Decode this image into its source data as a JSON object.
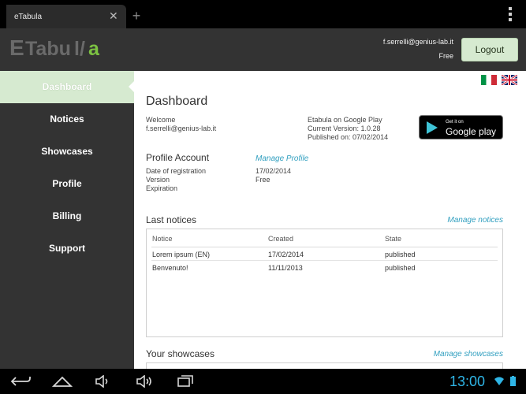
{
  "browser": {
    "tab_title": "eTabula",
    "tab_close": "✕",
    "new_tab": "+"
  },
  "header": {
    "logo_text": "ETabula",
    "user_email": "f.serrelli@genius-lab.it",
    "user_plan": "Free",
    "logout_label": "Logout"
  },
  "sidebar": {
    "items": [
      {
        "label": "Dashboard"
      },
      {
        "label": "Notices"
      },
      {
        "label": "Showcases"
      },
      {
        "label": "Profile"
      },
      {
        "label": "Billing"
      },
      {
        "label": "Support"
      }
    ]
  },
  "dashboard": {
    "title": "Dashboard",
    "welcome_label": "Welcome",
    "welcome_user": "f.serrelli@genius-lab.it",
    "gplay_title": "Etabula on Google Play",
    "current_version": "Current Version: 1.0.28",
    "published_on": "Published on: 07/02/2014",
    "badge_small": "Get it on",
    "badge_large": "Google play"
  },
  "profile": {
    "title": "Profile Account",
    "manage_link": "Manage Profile",
    "labels": [
      "Date of registration",
      "Version",
      "Expiration"
    ],
    "values": [
      "17/02/2014",
      "Free",
      ""
    ]
  },
  "notices": {
    "title": "Last notices",
    "manage_link": "Manage notices",
    "columns": [
      "Notice",
      "Created",
      "State"
    ],
    "rows": [
      [
        "Lorem ipsum (EN)",
        "17/02/2014",
        "published"
      ],
      [
        "Benvenuto!",
        "11/11/2013",
        "published"
      ]
    ]
  },
  "showcases": {
    "title": "Your showcases",
    "manage_link": "Manage showcases"
  },
  "system_bar": {
    "time": "13:00"
  },
  "colors": {
    "accent_green": "#d6ead0",
    "header_dark": "#333333",
    "link_blue": "#33a0c0",
    "clock_blue": "#2fb5e6"
  }
}
